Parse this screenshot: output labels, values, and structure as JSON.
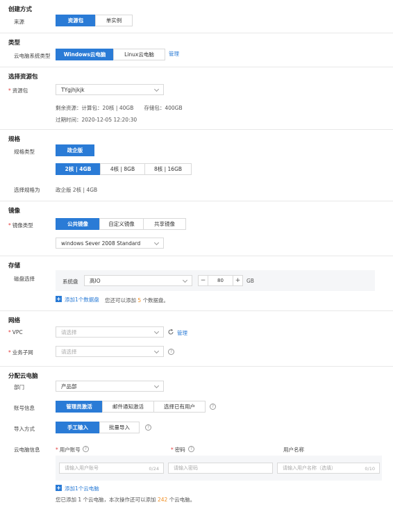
{
  "create": {
    "title": "创建方式",
    "source_label": "来源",
    "source_options": [
      "资源包",
      "单实例"
    ]
  },
  "type": {
    "title": "类型",
    "os_label": "云电脑系统类型",
    "os_options": [
      "Windows云电脑",
      "Linux云电脑"
    ],
    "manage_link": "管理"
  },
  "package": {
    "title": "选择资源包",
    "label": "资源包",
    "selected": "TYgjhjkjk",
    "remaining": "剩余资源：计算包：20核 | 40GB　　存储包：400GB",
    "expire": "过期时间：2020-12-05  12:20:30"
  },
  "spec": {
    "title": "规格",
    "type_label": "规格类型",
    "type_option": "政企版",
    "size_options": [
      "2核 | 4GB",
      "4核 | 8GB",
      "8核 | 16GB"
    ],
    "selected_label": "选择规格为",
    "selected_value": "政企版  2核 | 4GB"
  },
  "image": {
    "title": "镜像",
    "type_label": "镜像类型",
    "options": [
      "公共镜像",
      "自定义镜像",
      "共享镜像"
    ],
    "selected": "windows Sever 2008 Standard"
  },
  "storage": {
    "title": "存储",
    "disk_label": "磁盘选择",
    "system_disk": "系统盘",
    "disk_type": "高IO",
    "size": "80",
    "unit": "GB",
    "add_disk": "添加1个数据盘",
    "hint_prefix": "您还可以添加",
    "hint_count": "5",
    "hint_suffix": "个数据盘。"
  },
  "network": {
    "title": "网络",
    "vpc_label": "VPC",
    "vpc_placeholder": "请选择",
    "manage_link": "管理",
    "subnet_label": "业务子网",
    "subnet_placeholder": "请选择"
  },
  "assign": {
    "title": "分配云电脑",
    "dept_label": "部门",
    "dept_value": "产品部",
    "account_label": "账号信息",
    "account_options": [
      "管理员激活",
      "邮件通知激活",
      "选择已有用户"
    ],
    "import_label": "导入方式",
    "import_options": [
      "手工输入",
      "批量导入"
    ],
    "pc_info_label": "云电脑信息",
    "col_account": "用户账号",
    "col_password": "密码",
    "col_username": "用户名称",
    "account_placeholder": "请输入用户账号",
    "account_counter": "0/24",
    "password_placeholder": "请输入密码",
    "username_placeholder": "请输入用户名称（选填）",
    "username_counter": "0/10",
    "add_pc": "添加1个云电脑",
    "summary_prefix": "您已添加 1 个云电脑，本次操作还可以添加",
    "summary_count": "242",
    "summary_suffix": "个云电脑。"
  },
  "colors": {
    "primary": "#2a7bd6",
    "required": "#e23b3b",
    "highlight": "#f08c1e"
  }
}
